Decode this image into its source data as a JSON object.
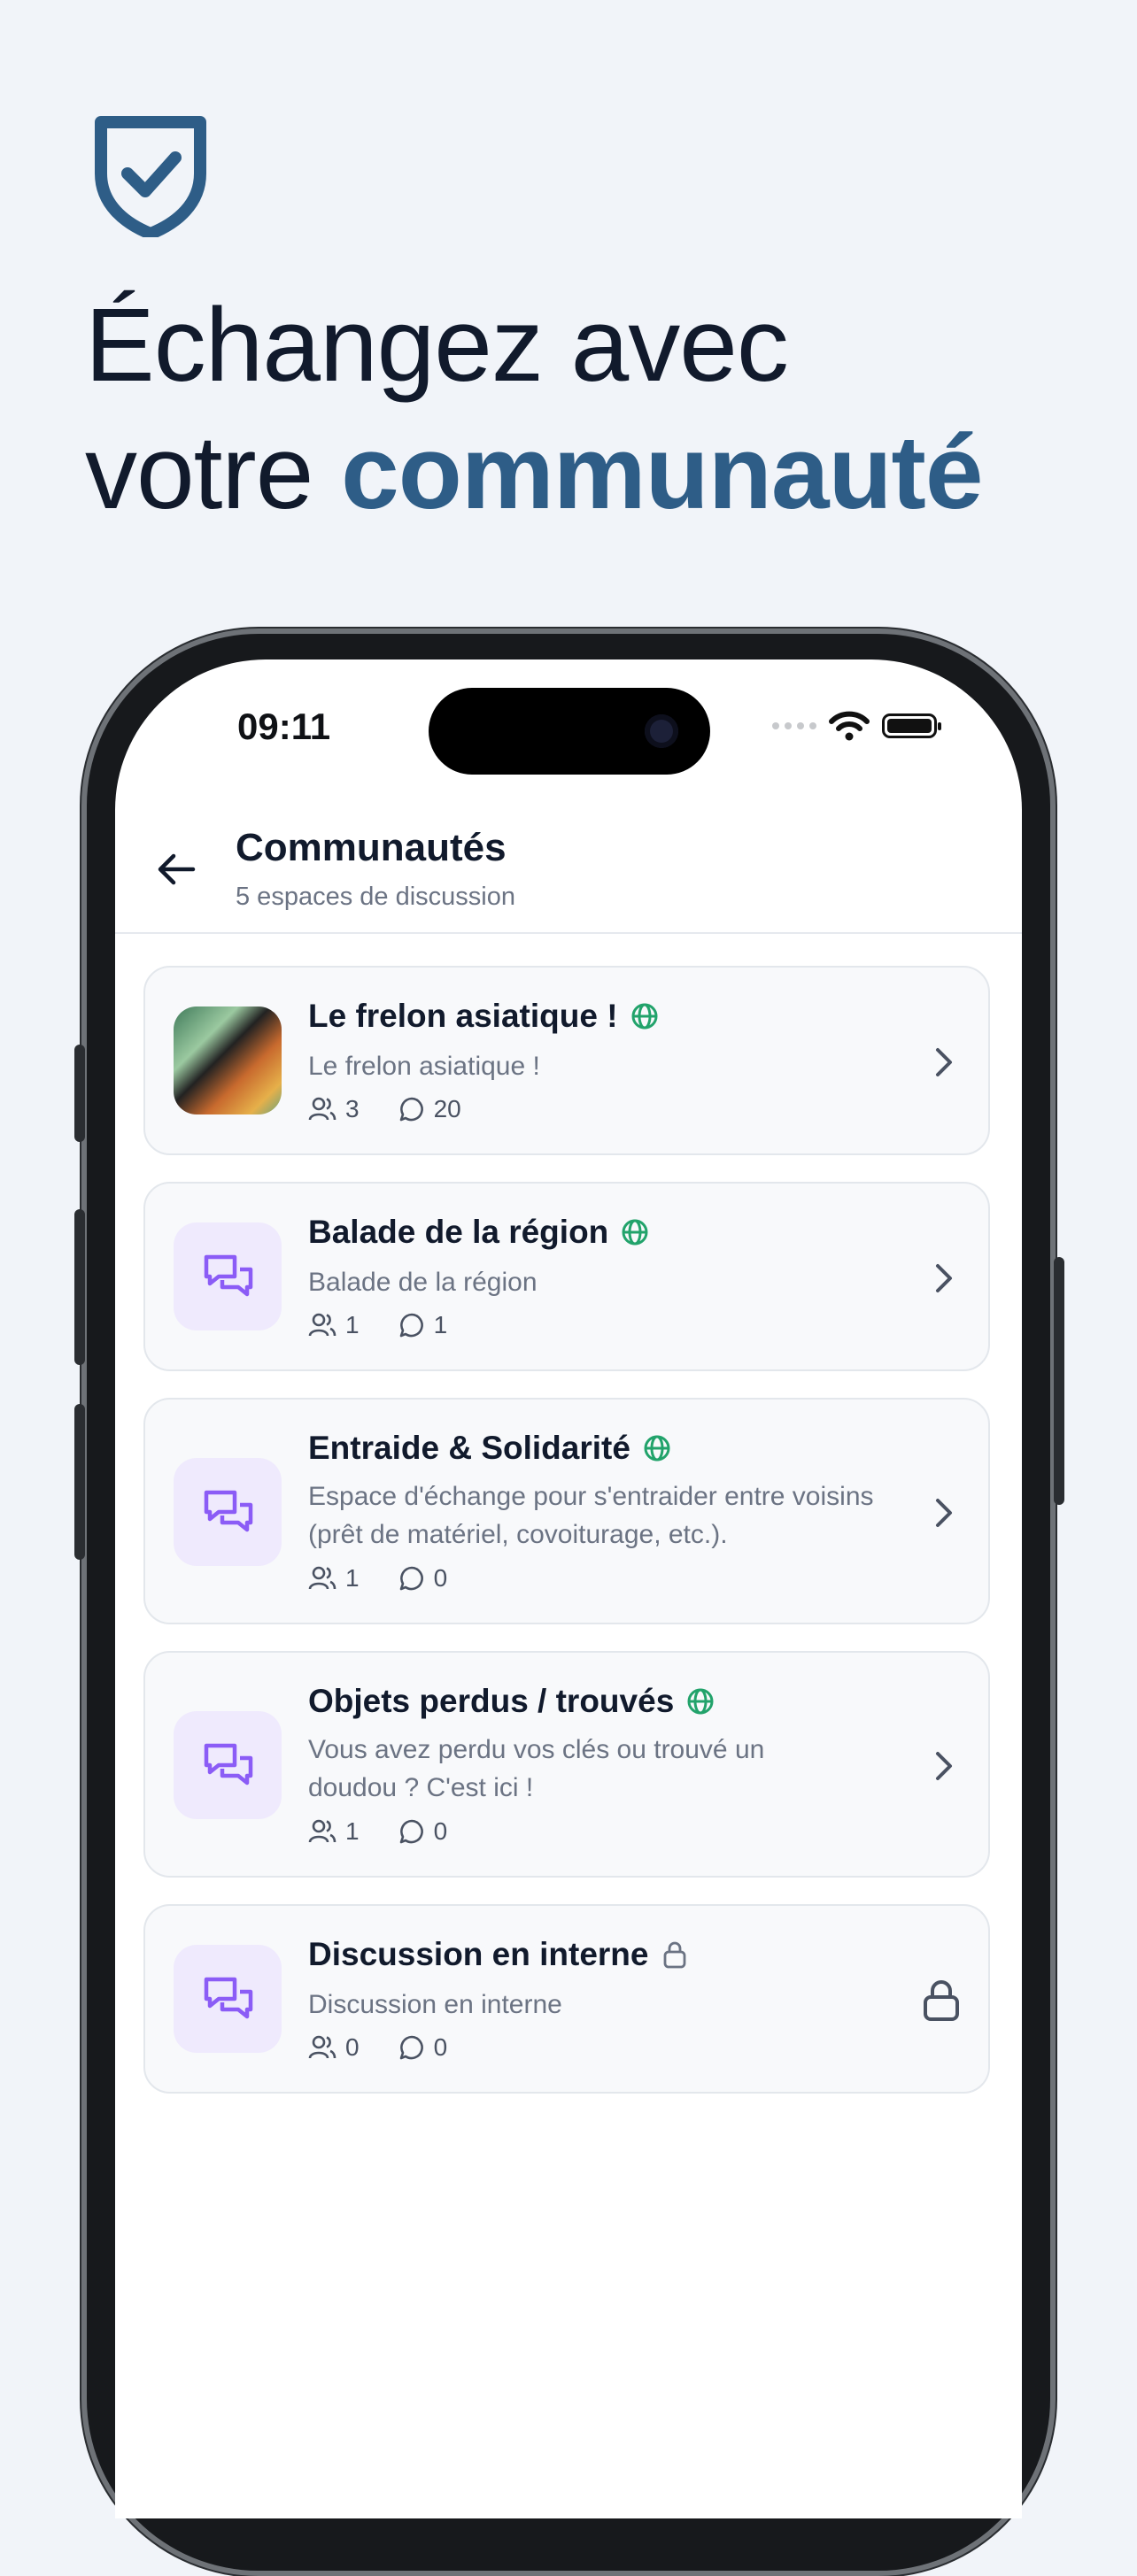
{
  "headline": {
    "line1": "Échangez avec",
    "line2_plain": "votre ",
    "line2_accent": "communauté"
  },
  "status": {
    "time": "09:11"
  },
  "header": {
    "title": "Communautés",
    "subtitle": "5 espaces de discussion"
  },
  "communities": [
    {
      "name": "Le frelon asiatique !",
      "description": "Le frelon asiatique !",
      "members": "3",
      "messages": "20",
      "visibility": "public",
      "icon": "photo-thumbnail"
    },
    {
      "name": "Balade de la région",
      "description": "Balade de la région",
      "members": "1",
      "messages": "1",
      "visibility": "public",
      "icon": "chat-bubbles-icon"
    },
    {
      "name": "Entraide & Solidarité",
      "description": "Espace d'échange pour s'entraider entre voisins (prêt de matériel, covoiturage, etc.).",
      "members": "1",
      "messages": "0",
      "visibility": "public",
      "icon": "chat-bubbles-icon"
    },
    {
      "name": "Objets perdus / trouvés",
      "description": "Vous avez perdu vos clés ou trouvé un doudou ? C'est ici !",
      "members": "1",
      "messages": "0",
      "visibility": "public",
      "icon": "chat-bubbles-icon"
    },
    {
      "name": "Discussion en interne",
      "description": "Discussion en interne",
      "members": "0",
      "messages": "0",
      "visibility": "private",
      "icon": "chat-bubbles-icon"
    }
  ],
  "colors": {
    "accent": "#2e5d87",
    "public_icon": "#22a36b",
    "chat_icon": "#8b5cf6",
    "background": "#f1f4f9"
  }
}
